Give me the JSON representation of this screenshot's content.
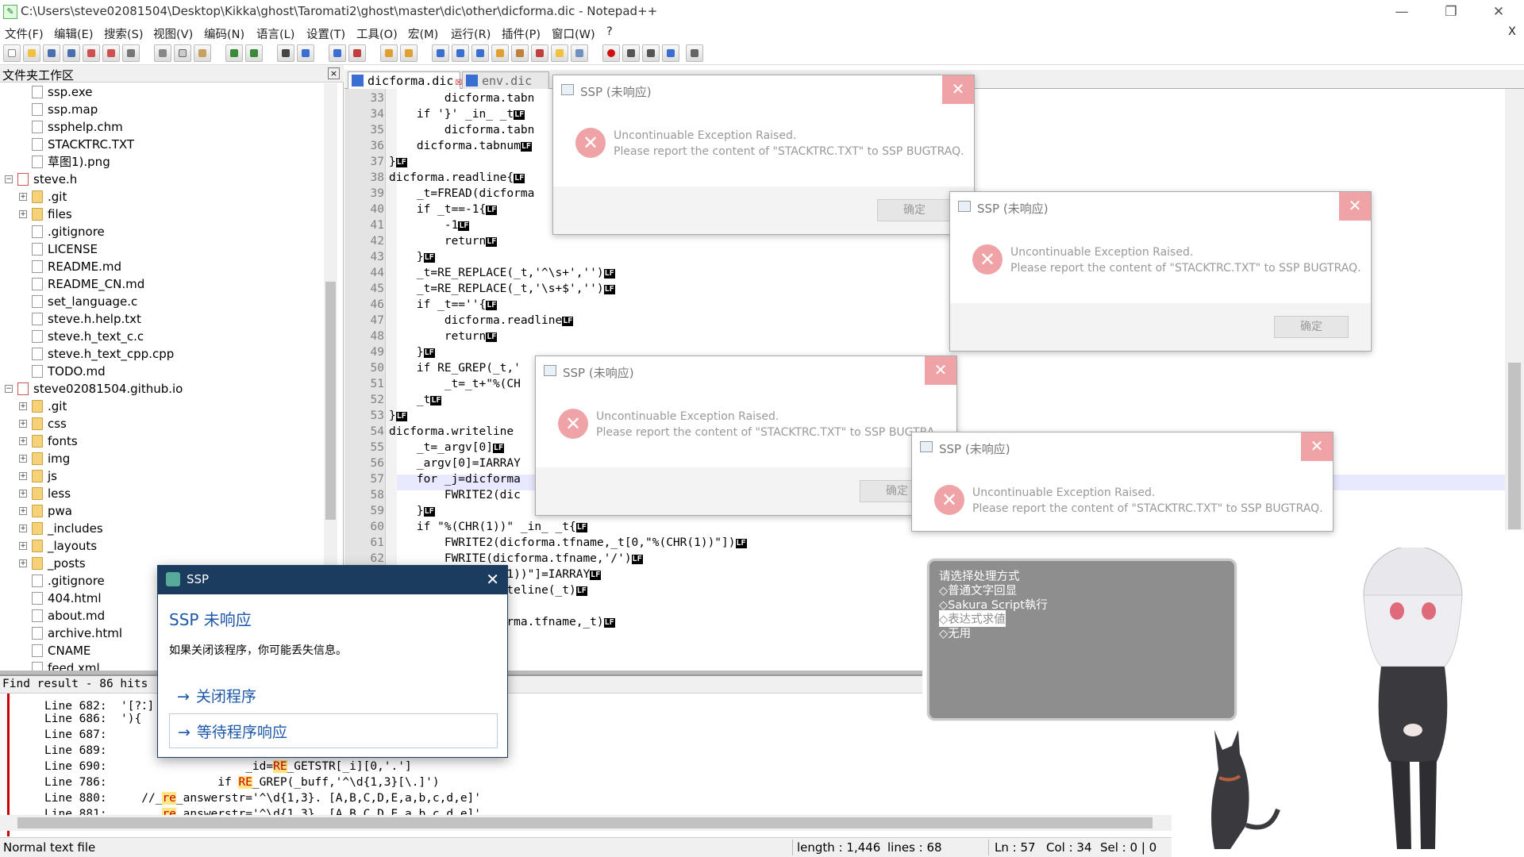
{
  "window": {
    "title": "C:\\Users\\steve02081504\\Desktop\\Kikka\\ghost\\Taromati2\\ghost\\master\\dic\\other\\dicforma.dic - Notepad++",
    "minimize": "—",
    "restore": "❐",
    "close": "✕",
    "close_doc": "X"
  },
  "menu": [
    "文件(F)",
    "编辑(E)",
    "搜索(S)",
    "视图(V)",
    "编码(N)",
    "语言(L)",
    "设置(T)",
    "工具(O)",
    "宏(M)",
    "运行(R)",
    "插件(P)",
    "窗口(W)",
    "?"
  ],
  "folder_pane": {
    "title": "文件夹工作区",
    "close": "×",
    "items": [
      {
        "label": "ssp.exe",
        "type": "file",
        "level": 2
      },
      {
        "label": "ssp.map",
        "type": "file",
        "level": 2
      },
      {
        "label": "ssphelp.chm",
        "type": "file",
        "level": 2
      },
      {
        "label": "STACKTRC.TXT",
        "type": "file",
        "level": 2
      },
      {
        "label": "草图1).png",
        "type": "file",
        "level": 2
      },
      {
        "label": "steve.h",
        "type": "project",
        "level": 1
      },
      {
        "label": ".git",
        "type": "folder",
        "level": 2
      },
      {
        "label": "files",
        "type": "folder",
        "level": 2
      },
      {
        "label": ".gitignore",
        "type": "file",
        "level": 2
      },
      {
        "label": "LICENSE",
        "type": "file",
        "level": 2
      },
      {
        "label": "README.md",
        "type": "file",
        "level": 2
      },
      {
        "label": "README_CN.md",
        "type": "file",
        "level": 2
      },
      {
        "label": "set_language.c",
        "type": "file",
        "level": 2
      },
      {
        "label": "steve.h.help.txt",
        "type": "file",
        "level": 2
      },
      {
        "label": "steve.h_text_c.c",
        "type": "file",
        "level": 2
      },
      {
        "label": "steve.h_text_cpp.cpp",
        "type": "file",
        "level": 2
      },
      {
        "label": "TODO.md",
        "type": "file",
        "level": 2
      },
      {
        "label": "steve02081504.github.io",
        "type": "project",
        "level": 1
      },
      {
        "label": ".git",
        "type": "folder",
        "level": 2
      },
      {
        "label": "css",
        "type": "folder",
        "level": 2
      },
      {
        "label": "fonts",
        "type": "folder",
        "level": 2
      },
      {
        "label": "img",
        "type": "folder",
        "level": 2
      },
      {
        "label": "js",
        "type": "folder",
        "level": 2
      },
      {
        "label": "less",
        "type": "folder",
        "level": 2
      },
      {
        "label": "pwa",
        "type": "folder",
        "level": 2
      },
      {
        "label": "_includes",
        "type": "folder",
        "level": 2
      },
      {
        "label": "_layouts",
        "type": "folder",
        "level": 2
      },
      {
        "label": "_posts",
        "type": "folder",
        "level": 2
      },
      {
        "label": ".gitignore",
        "type": "file",
        "level": 2
      },
      {
        "label": "404.html",
        "type": "file",
        "level": 2
      },
      {
        "label": "about.md",
        "type": "file",
        "level": 2
      },
      {
        "label": "archive.html",
        "type": "file",
        "level": 2
      },
      {
        "label": "CNAME",
        "type": "file",
        "level": 2
      },
      {
        "label": "feed.xml",
        "type": "file",
        "level": 2
      }
    ]
  },
  "tabs": [
    {
      "label": "dicforma.dic",
      "active": true,
      "close": "☒"
    },
    {
      "label": "env.dic",
      "active": false,
      "close": "☒"
    }
  ],
  "editor": {
    "lines": [
      {
        "n": "33",
        "code": "\t\tdicforma.tabn",
        "lf": false
      },
      {
        "n": "34",
        "code": "\tif '}' _in_ _t",
        "lf": true
      },
      {
        "n": "35",
        "code": "\t\tdicforma.tabn",
        "lf": false
      },
      {
        "n": "36",
        "code": "\tdicforma.tabnum",
        "lf": true
      },
      {
        "n": "37",
        "code": "}",
        "lf": true
      },
      {
        "n": "38",
        "code": "dicforma.readline{",
        "lf": true
      },
      {
        "n": "39",
        "code": "\t_t=FREAD(dicforma",
        "lf": false
      },
      {
        "n": "40",
        "code": "\tif _t==-1{",
        "lf": true
      },
      {
        "n": "41",
        "code": "\t\t-1",
        "lf": true
      },
      {
        "n": "42",
        "code": "\t\treturn",
        "lf": true
      },
      {
        "n": "43",
        "code": "\t}",
        "lf": true
      },
      {
        "n": "44",
        "code": "\t_t=RE_REPLACE(_t,'^\\s+','')",
        "lf": true
      },
      {
        "n": "45",
        "code": "\t_t=RE_REPLACE(_t,'\\s+$','')",
        "lf": true
      },
      {
        "n": "46",
        "code": "\tif _t==''{",
        "lf": true
      },
      {
        "n": "47",
        "code": "\t\tdicforma.readline",
        "lf": true
      },
      {
        "n": "48",
        "code": "\t\treturn",
        "lf": true
      },
      {
        "n": "49",
        "code": "\t}",
        "lf": true
      },
      {
        "n": "50",
        "code": "\tif RE_GREP(_t,'",
        "lf": false
      },
      {
        "n": "51",
        "code": "\t\t_t=_t+\"%(CH",
        "lf": false
      },
      {
        "n": "52",
        "code": "\t_t",
        "lf": true
      },
      {
        "n": "53",
        "code": "}",
        "lf": true
      },
      {
        "n": "54",
        "code": "dicforma.writeline",
        "lf": false
      },
      {
        "n": "55",
        "code": "\t_t=_argv[0]",
        "lf": true
      },
      {
        "n": "56",
        "code": "\t_argv[0]=IARRAY",
        "lf": false
      },
      {
        "n": "57",
        "code": "\tfor _j=dicforma",
        "lf": false
      },
      {
        "n": "58",
        "code": "\t\tFWRITE2(dic",
        "lf": false
      },
      {
        "n": "59",
        "code": "\t}",
        "lf": true
      },
      {
        "n": "60",
        "code": "\tif \"%(CHR(1))\" _in_ _t{",
        "lf": true
      },
      {
        "n": "61",
        "code": "\t\tFWRITE2(dicforma.tfname,_t[0,\"%(CHR(1))\"])",
        "lf": true
      },
      {
        "n": "62",
        "code": "\t\tFWRITE(dicforma.tfname,'/')",
        "lf": true
      },
      {
        "n": "",
        "code": "\t\t\t(CHR(1))\"]=IARRAY",
        "lf": true
      },
      {
        "n": "",
        "code": "\t\t\ta.writeline(_t)",
        "lf": true
      },
      {
        "n": "",
        "code": "",
        "lf": false
      },
      {
        "n": "",
        "code": "\t\t\tdicforma.tfname,_t)",
        "lf": true
      }
    ],
    "lf_label": "LF"
  },
  "find_result": {
    "header": "Find result - 86 hits",
    "lines": [
      {
        "label": "Line 682:",
        "pre": "",
        "hl": "",
        "post": "'[?：]','()'"
      },
      {
        "label": "Line 686:",
        "pre": "",
        "hl": "",
        "post": "'){"
      },
      {
        "label": "Line 687:",
        "pre": "",
        "hl": "",
        "post": ""
      },
      {
        "label": "Line 689:",
        "pre": "",
        "hl": "",
        "post": ""
      },
      {
        "label": "Line 690:",
        "pre": "                  _id=",
        "hl": "RE",
        "post": "_GETSTR[_i][0,'.']"
      },
      {
        "label": "Line 786:",
        "pre": "              if ",
        "hl": "RE",
        "post": "_GREP(_buff,'^\\d{1,3}[\\.]')"
      },
      {
        "label": "Line 880:",
        "pre": "   //_",
        "hl": "re",
        "post": "_answerstr='^\\d{1,3}. [A,B,C,D,E,a,b,c,d,e]'"
      },
      {
        "label": "Line 881:",
        "pre": "     _",
        "hl": "re",
        "post": "_answerstr='^\\d{1,3}. [A,B,C,D,E,a,b,c,d,e]'"
      }
    ]
  },
  "status": {
    "type": "Normal text file",
    "length": "length : 1,446",
    "lines": "lines : 68",
    "ln": "Ln : 57",
    "col": "Col : 34",
    "sel": "Sel : 0 | 0"
  },
  "ssp_dialogs": [
    {
      "title": "SSP (未响应)",
      "msg1": "Uncontinuable Exception Raised.",
      "msg2": "Please report the content of \"STACKTRC.TXT\" to SSP BUGTRAQ.",
      "ok": "确定",
      "close": "✕",
      "err": "✕"
    },
    {
      "title": "SSP (未响应)",
      "msg1": "Uncontinuable Exception Raised.",
      "msg2": "Please report the content of \"STACKTRC.TXT\" to SSP BUGTRAQ.",
      "ok": "确定",
      "close": "✕",
      "err": "✕"
    },
    {
      "title": "SSP (未响应)",
      "msg1": "Uncontinuable Exception Raised.",
      "msg2": "Please report the content of \"STACKTRC.TXT\" to SSP BUGTRA",
      "ok": "确定",
      "close": "✕",
      "err": "✕"
    },
    {
      "title": "SSP (未响应)",
      "msg1": "Uncontinuable Exception Raised.",
      "msg2": "Please report the content of \"STACKTRC.TXT\" to SSP BUGTRAQ.",
      "ok": "确定",
      "close": "✕",
      "err": "✕"
    }
  ],
  "not_responding": {
    "title": "SSP",
    "close": "✕",
    "heading": "SSP 未响应",
    "desc": "如果关闭该程序，你可能丢失信息。",
    "option_close": "关闭程序",
    "option_wait": "等待程序响应",
    "arrow": "→"
  },
  "balloon": {
    "lines": [
      "请选择处理方式",
      "◇普通文字回显",
      "◇Sakura Script執行",
      "◇表达式求値",
      "◇无用"
    ],
    "selected_index": 3
  },
  "colors": {
    "ssp_close": "#f0a3a6",
    "dialog_title": "#1b3b5f",
    "link_blue": "#1d58a8",
    "balloon_bg": "#8e8e8e"
  }
}
